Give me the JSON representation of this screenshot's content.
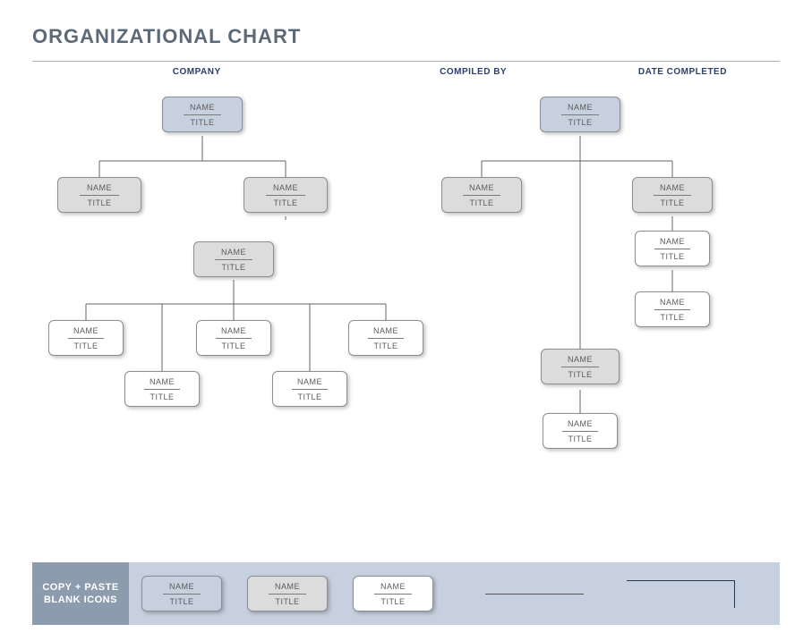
{
  "title": "ORGANIZATIONAL CHART",
  "headers": {
    "company": "COMPANY",
    "compiled_by": "COMPILED BY",
    "date_completed": "DATE COMPLETED"
  },
  "node_label": {
    "name": "NAME",
    "title": "TITLE"
  },
  "footer": {
    "label_line1": "COPY + PASTE",
    "label_line2": "BLANK ICONS"
  }
}
